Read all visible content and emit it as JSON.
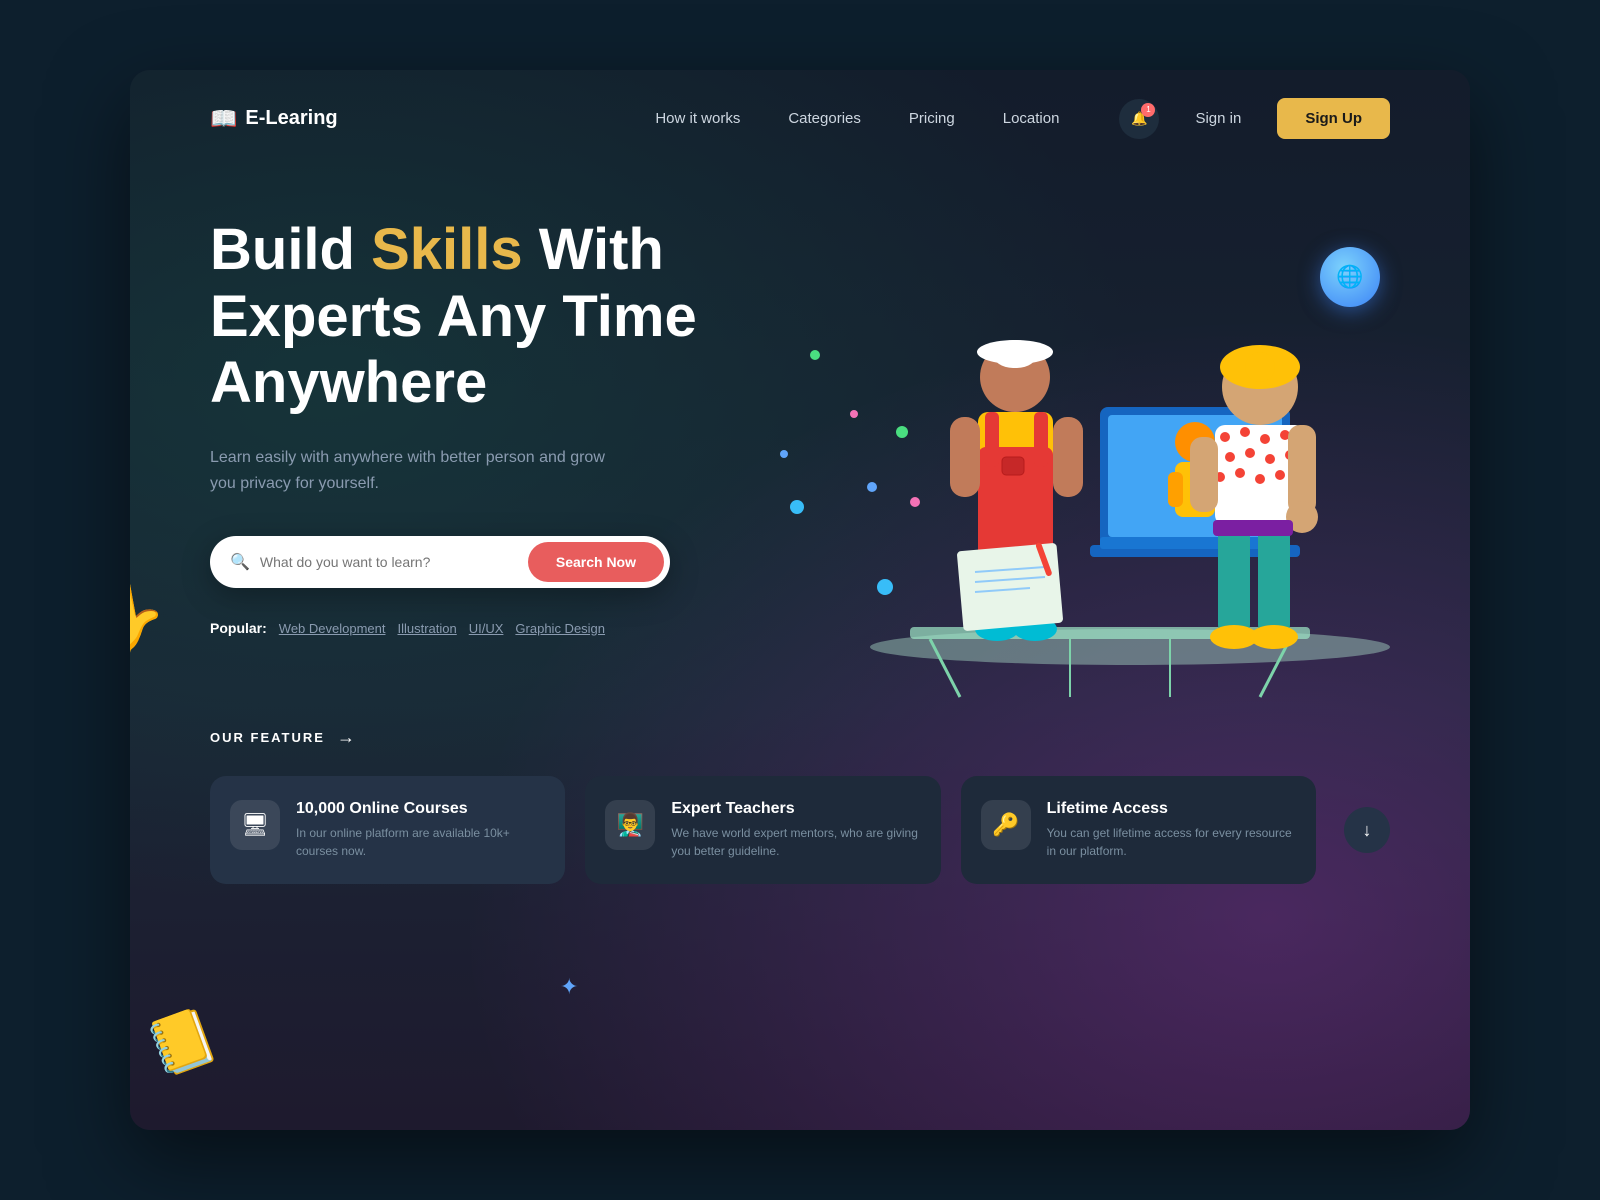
{
  "app": {
    "title": "E-Learing",
    "logo_icon": "📖"
  },
  "navbar": {
    "links": [
      {
        "id": "how-it-works",
        "label": "How it works"
      },
      {
        "id": "categories",
        "label": "Categories"
      },
      {
        "id": "pricing",
        "label": "Pricing"
      },
      {
        "id": "location",
        "label": "Location"
      }
    ],
    "bell_count": "1",
    "signin_label": "Sign in",
    "signup_label": "Sign Up"
  },
  "hero": {
    "title_part1": "Build ",
    "title_highlight": "Skills",
    "title_part2": " With",
    "title_line2": "Experts Any Time",
    "title_line3": "Anywhere",
    "subtitle": "Learn easily with anywhere with better person and grow you privacy for yourself.",
    "search_placeholder": "What do you want to learn?",
    "search_btn_label": "Search Now",
    "popular_label": "Popular:",
    "popular_tags": [
      "Web Development",
      "Illustration",
      "UI/UX",
      "Graphic Design"
    ]
  },
  "feature_section": {
    "heading": "OUR FEATURE",
    "arrow": "→",
    "cards": [
      {
        "id": "online-courses",
        "icon": "🖥",
        "title": "10,000 Online Courses",
        "description": "In our online platform are available 10k+ courses now."
      },
      {
        "id": "expert-teachers",
        "icon": "👨‍🏫",
        "title": "Expert Teachers",
        "description": "We have world expert mentors, who are giving you better guideline."
      },
      {
        "id": "lifetime-access",
        "icon": "🔑",
        "title": "Lifetime Access",
        "description": "You can get lifetime access for every resource in our platform."
      }
    ],
    "scroll_btn_label": "↓"
  },
  "decorative": {
    "globe_icon": "🌐",
    "cursor_icon": "✦",
    "book_icon": "📒"
  }
}
